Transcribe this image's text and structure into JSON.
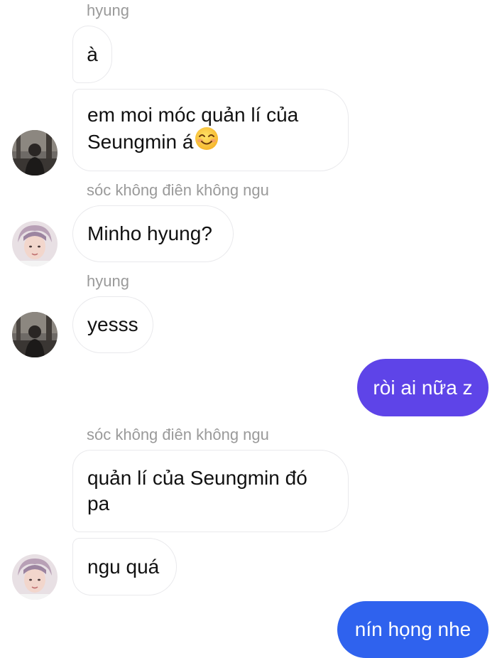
{
  "theme": {
    "outgoing_color_1": "#5e44e8",
    "outgoing_color_2": "#2f62ee",
    "incoming_border": "#e9e9ec",
    "name_color": "#9a9a9a"
  },
  "messages": [
    {
      "type": "name",
      "text": "hyung"
    },
    {
      "type": "incoming",
      "text": "à"
    },
    {
      "type": "incoming",
      "text": "em moi móc quản lí của",
      "text2": "Seungmin á",
      "emoji": "smiling-face-with-smiling-eyes"
    },
    {
      "type": "name",
      "text": "sóc không điên không ngu"
    },
    {
      "type": "incoming",
      "text": "Minho hyung?"
    },
    {
      "type": "name",
      "text": "hyung"
    },
    {
      "type": "incoming",
      "text": "yesss"
    },
    {
      "type": "outgoing",
      "text": "ròi ai nữa z"
    },
    {
      "type": "name",
      "text": "sóc không điên không ngu"
    },
    {
      "type": "incoming",
      "text": "quản lí của Seungmin đó",
      "text2": "pa"
    },
    {
      "type": "incoming",
      "text": "ngu quá"
    },
    {
      "type": "outgoing",
      "text": "nín họng nhe"
    }
  ]
}
